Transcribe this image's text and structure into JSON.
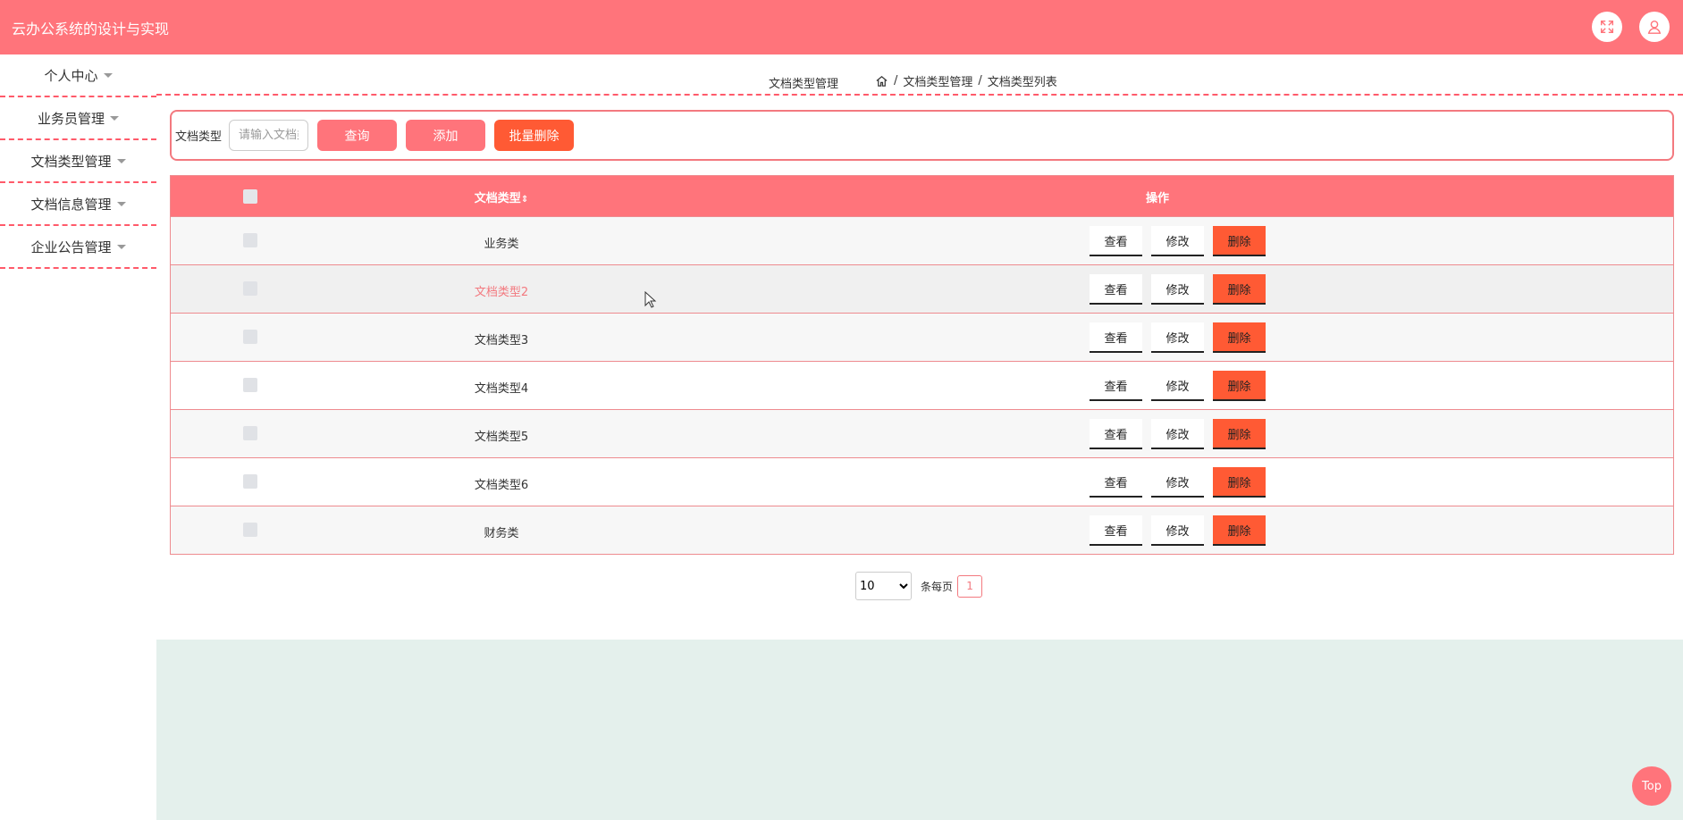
{
  "app": {
    "title": "云办公系统的设计与实现"
  },
  "sidebar": {
    "items": [
      {
        "label": "个人中心"
      },
      {
        "label": "业务员管理"
      },
      {
        "label": "文档类型管理"
      },
      {
        "label": "文档信息管理"
      },
      {
        "label": "企业公告管理"
      }
    ]
  },
  "breadcrumb": {
    "page_title": "文档类型管理",
    "path": [
      "文档类型管理",
      "文档类型列表"
    ],
    "separator": "/"
  },
  "search": {
    "label": "文档类型",
    "placeholder": "请输入文档类型",
    "query_label": "查询",
    "add_label": "添加",
    "batch_delete_label": "批量删除"
  },
  "table": {
    "columns": {
      "type": "文档类型",
      "sort_icon": "⇕",
      "ops": "操作"
    },
    "rows": [
      {
        "type": "业务类"
      },
      {
        "type": "文档类型2"
      },
      {
        "type": "文档类型3"
      },
      {
        "type": "文档类型4"
      },
      {
        "type": "文档类型5"
      },
      {
        "type": "文档类型6"
      },
      {
        "type": "财务类"
      }
    ],
    "actions": {
      "view": "查看",
      "edit": "修改",
      "delete": "删除"
    }
  },
  "pager": {
    "page_size": "10",
    "page_size_options": [
      "10"
    ],
    "per_page_label": "条每页",
    "current_page": "1"
  },
  "back_to_top": "Top",
  "colors": {
    "primary": "#ff747b",
    "danger": "#ff5a34",
    "footer": "#e4f0ec"
  }
}
